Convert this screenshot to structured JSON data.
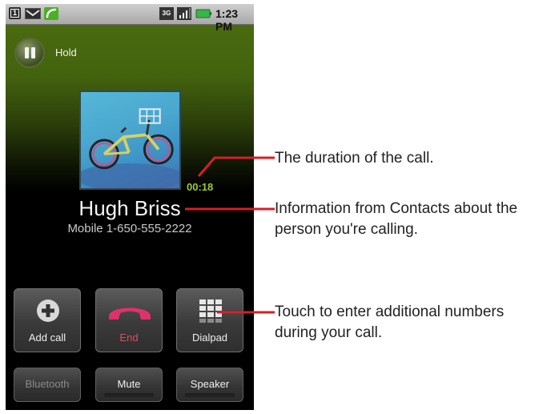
{
  "status_bar": {
    "time": "1:23 PM",
    "icons": [
      "sim-1-icon",
      "gmail-icon",
      "call-in-progress-icon",
      "3g-icon",
      "signal-icon",
      "battery-icon"
    ],
    "sim_digit": "1"
  },
  "call": {
    "hold_label": "Hold",
    "duration": "00:18",
    "caller_name": "Hugh Briss",
    "caller_number": "Mobile 1-650-555-2222"
  },
  "buttons": {
    "add_call": "Add call",
    "end": "End",
    "dialpad": "Dialpad",
    "bluetooth": "Bluetooth",
    "mute": "Mute",
    "speaker": "Speaker"
  },
  "callouts": {
    "duration": "The duration of the call.",
    "contact_line1": "Information from Contacts about the",
    "contact_line2": "person you're calling.",
    "dialpad_line1": "Touch to enter additional numbers",
    "dialpad_line2": "during your call."
  },
  "colors": {
    "accent_green": "#9ccc2e",
    "end_red": "#e14c5b",
    "callout_line": "#d81f26"
  }
}
